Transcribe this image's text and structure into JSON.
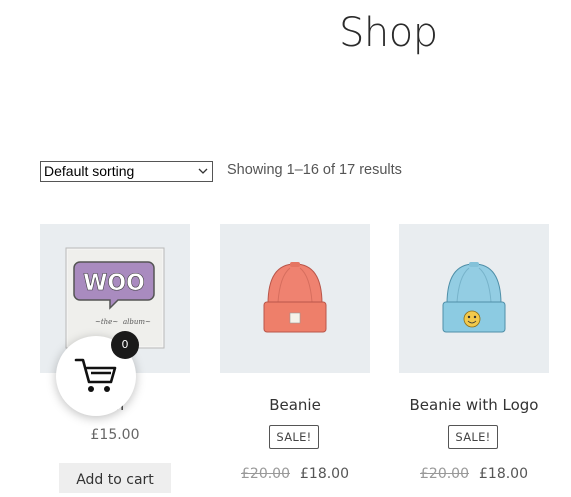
{
  "page": {
    "title": "Shop"
  },
  "toolbar": {
    "sort_selected": "Default sorting",
    "result_count": "Showing 1–16 of 17 results"
  },
  "products": [
    {
      "title": "Album",
      "visible_title": "um",
      "price": "£15.00",
      "button": "Add to cart",
      "image": "woo-album-image"
    },
    {
      "title": "Beanie",
      "badge": "SALE!",
      "old_price": "£20.00",
      "price": "£18.00",
      "image": "orange-beanie-image"
    },
    {
      "title": "Beanie with Logo",
      "badge": "SALE!",
      "old_price": "£20.00",
      "price": "£18.00",
      "image": "blue-beanie-logo-image"
    }
  ],
  "cart": {
    "count": "0",
    "icon": "cart-icon"
  },
  "colors": {
    "thumb_bg": "#e9edf0",
    "badge_bg": "#1a1a1a",
    "beanie_orange": "#ee7f6a",
    "beanie_blue": "#8ccbe2",
    "woo_purple": "#a98bbf"
  }
}
